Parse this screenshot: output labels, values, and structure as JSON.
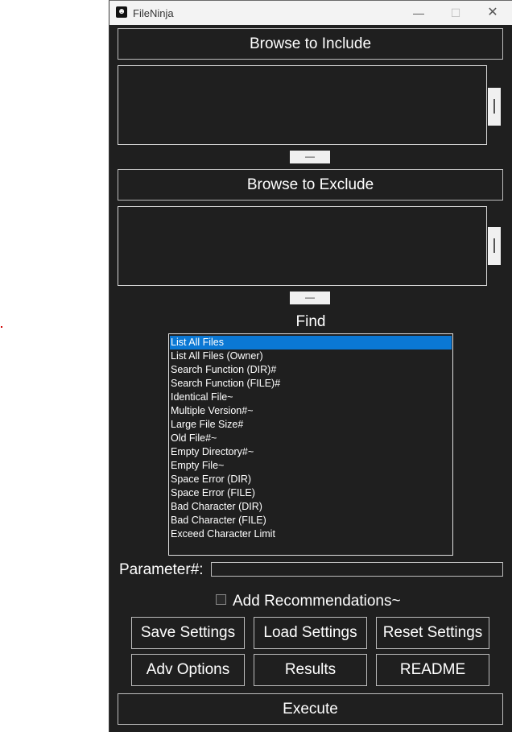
{
  "window": {
    "title": "FileNinja",
    "icon": "ninja-app-icon"
  },
  "title_controls": {
    "minimize": "—",
    "maximize": "☐",
    "close": "✕"
  },
  "include": {
    "browse_label": "Browse to Include",
    "remove_label": "—"
  },
  "exclude": {
    "browse_label": "Browse to Exclude",
    "remove_label": "—"
  },
  "find": {
    "label": "Find",
    "selected_index": 0,
    "items": [
      "List All Files",
      "List All Files (Owner)",
      "Search Function (DIR)#",
      "Search Function (FILE)#",
      "Identical File~",
      "Multiple Version#~",
      "Large File Size#",
      "Old File#~",
      "Empty Directory#~",
      "Empty File~",
      "Space Error (DIR)",
      "Space Error (FILE)",
      "Bad Character (DIR)",
      "Bad Character (FILE)",
      "Exceed Character Limit"
    ]
  },
  "parameter": {
    "label": "Parameter#:",
    "value": ""
  },
  "recommendations": {
    "label": "Add Recommendations~",
    "checked": false
  },
  "buttons": {
    "save": "Save Settings",
    "load": "Load Settings",
    "reset": "Reset Settings",
    "adv": "Adv Options",
    "results": "Results",
    "readme": "README",
    "execute": "Execute"
  },
  "colors": {
    "background": "#1f1f1f",
    "selection": "#0b78d4",
    "border": "#bdbdbd",
    "text": "#ffffff"
  }
}
